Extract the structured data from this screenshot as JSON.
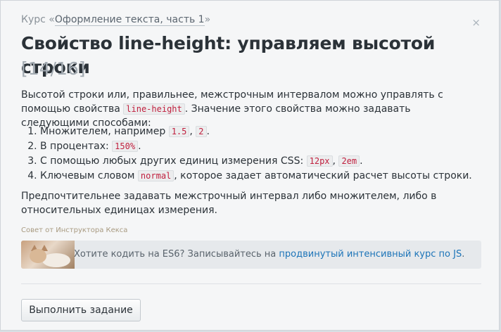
{
  "breadcrumb": {
    "prefix": "Курс «",
    "course_link": "Оформление текста, часть 1",
    "suffix": "»"
  },
  "close_glyph": "×",
  "title": "Свойство line-height: управляем высотой строки",
  "counter": "[14/16]",
  "intro": {
    "text_before": "Высотой строки или, правильнее, межстрочным интервалом можно управлять с помощью свойства ",
    "code": "line-height",
    "text_after": ". Значение этого свойства можно задавать следующими способами:"
  },
  "list": [
    {
      "text": "Множителем, например ",
      "code1": "1.5",
      "sep": ", ",
      "code2": "2",
      "end": "."
    },
    {
      "text": "В процентах: ",
      "code1": "150%",
      "end": "."
    },
    {
      "text": "С помощью любых других единиц измерения CSS: ",
      "code1": "12px",
      "sep": ", ",
      "code2": "2em",
      "end": "."
    },
    {
      "text": "Ключевым словом ",
      "code1": "normal",
      "end": ", которое задает автоматический расчет высоты строки."
    }
  ],
  "conclusion": "Предпочтительнее задавать межстрочный интервал либо множителем, либо в относительных единицах измерения.",
  "tip": {
    "label": "Совет от Инструктора Кекса",
    "text": "Хотите кодить на ES6? Записывайтесь на ",
    "link": "продвинутый интенсивный курс по JS",
    "end": "."
  },
  "action_button": "Выполнить задание",
  "colors": {
    "code_text": "#c0203f",
    "link": "#1c74b8",
    "background": "#f5f6f7"
  }
}
